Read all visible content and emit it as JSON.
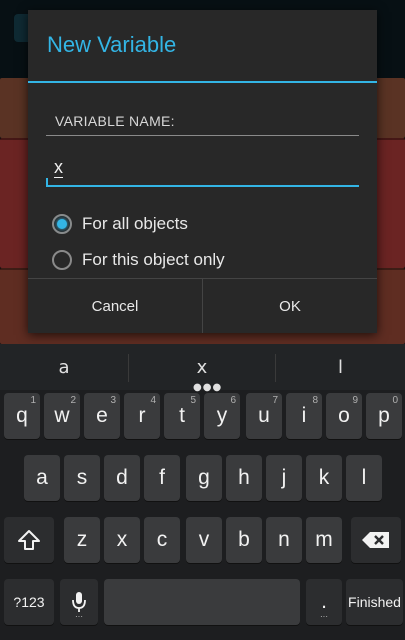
{
  "dialog": {
    "title": "New Variable",
    "name_label": "VARIABLE NAME:",
    "name_value": "x",
    "options": [
      {
        "label": "For all objects",
        "checked": true
      },
      {
        "label": "For this object only",
        "checked": false
      }
    ],
    "cancel_label": "Cancel",
    "ok_label": "OK"
  },
  "keyboard": {
    "suggestions": [
      "a",
      "x",
      "l"
    ],
    "row1": [
      {
        "k": "q",
        "hint": "1"
      },
      {
        "k": "w",
        "hint": "2"
      },
      {
        "k": "e",
        "hint": "3"
      },
      {
        "k": "r",
        "hint": "4"
      },
      {
        "k": "t",
        "hint": "5"
      },
      {
        "k": "y",
        "hint": "6"
      },
      {
        "k": "u",
        "hint": "7"
      },
      {
        "k": "i",
        "hint": "8"
      },
      {
        "k": "o",
        "hint": "9"
      },
      {
        "k": "p",
        "hint": "0"
      }
    ],
    "row2": [
      "a",
      "s",
      "d",
      "f",
      "g",
      "h",
      "j",
      "k",
      "l"
    ],
    "row3": [
      "z",
      "x",
      "c",
      "v",
      "b",
      "n",
      "m"
    ],
    "symbols_label": "?123",
    "period_label": ".",
    "finished_label": "Finished"
  },
  "colors": {
    "accent": "#33b5e5",
    "dialog_bg": "#282828",
    "key_bg": "#3a3b3d",
    "keyboard_bg": "#1d1e20"
  }
}
